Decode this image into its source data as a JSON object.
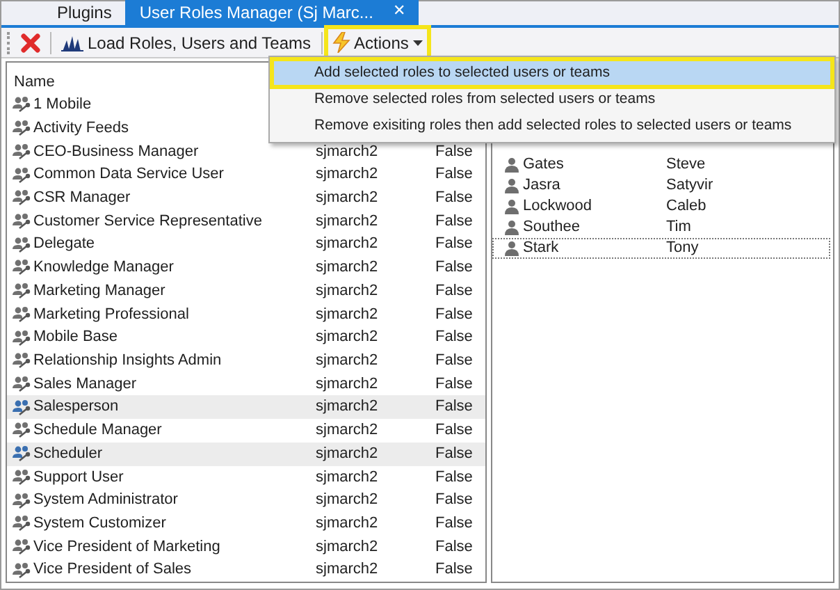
{
  "tabs": [
    {
      "label": "Plugins",
      "selected": false,
      "closable": false
    },
    {
      "label": "User Roles Manager (Sj Marc...",
      "selected": true,
      "closable": true,
      "close": "✕"
    }
  ],
  "toolbar": {
    "load_label": "Load Roles, Users and Teams",
    "actions_label": "Actions",
    "actions_highlighted": true
  },
  "menu": {
    "open": true,
    "items": [
      {
        "label": "Add selected roles to selected users or teams",
        "selected": true
      },
      {
        "label": "Remove selected roles from selected users or teams",
        "selected": false
      },
      {
        "label": "Remove exisiting roles then add selected roles to selected users or teams",
        "selected": false
      }
    ]
  },
  "roles": {
    "columns": [
      "Name"
    ],
    "rows": [
      {
        "name": "1 Mobile",
        "owner": "",
        "managed": "",
        "selected": false
      },
      {
        "name": "Activity Feeds",
        "owner": "",
        "managed": "",
        "selected": false
      },
      {
        "name": "CEO-Business Manager",
        "owner": "sjmarch2",
        "managed": "False",
        "selected": false
      },
      {
        "name": "Common Data Service User",
        "owner": "sjmarch2",
        "managed": "False",
        "selected": false
      },
      {
        "name": "CSR Manager",
        "owner": "sjmarch2",
        "managed": "False",
        "selected": false
      },
      {
        "name": "Customer Service Representative",
        "owner": "sjmarch2",
        "managed": "False",
        "selected": false
      },
      {
        "name": "Delegate",
        "owner": "sjmarch2",
        "managed": "False",
        "selected": false
      },
      {
        "name": "Knowledge Manager",
        "owner": "sjmarch2",
        "managed": "False",
        "selected": false
      },
      {
        "name": "Marketing Manager",
        "owner": "sjmarch2",
        "managed": "False",
        "selected": false
      },
      {
        "name": "Marketing Professional",
        "owner": "sjmarch2",
        "managed": "False",
        "selected": false
      },
      {
        "name": "Mobile Base",
        "owner": "sjmarch2",
        "managed": "False",
        "selected": false
      },
      {
        "name": "Relationship Insights Admin",
        "owner": "sjmarch2",
        "managed": "False",
        "selected": false
      },
      {
        "name": "Sales Manager",
        "owner": "sjmarch2",
        "managed": "False",
        "selected": false
      },
      {
        "name": "Salesperson",
        "owner": "sjmarch2",
        "managed": "False",
        "selected": true
      },
      {
        "name": "Schedule Manager",
        "owner": "sjmarch2",
        "managed": "False",
        "selected": false
      },
      {
        "name": "Scheduler",
        "owner": "sjmarch2",
        "managed": "False",
        "selected": true
      },
      {
        "name": "Support User",
        "owner": "sjmarch2",
        "managed": "False",
        "selected": false
      },
      {
        "name": "System Administrator",
        "owner": "sjmarch2",
        "managed": "False",
        "selected": false
      },
      {
        "name": "System Customizer",
        "owner": "sjmarch2",
        "managed": "False",
        "selected": false
      },
      {
        "name": "Vice President of Marketing",
        "owner": "sjmarch2",
        "managed": "False",
        "selected": false
      },
      {
        "name": "Vice President of Sales",
        "owner": "sjmarch2",
        "managed": "False",
        "selected": false
      }
    ]
  },
  "users": {
    "rows": [
      {
        "last_name": "Gates",
        "first_name": "Steve",
        "focused": false
      },
      {
        "last_name": "Jasra",
        "first_name": "Satyvir",
        "focused": false
      },
      {
        "last_name": "Lockwood",
        "first_name": "Caleb",
        "focused": false
      },
      {
        "last_name": "Southee",
        "first_name": "Tim",
        "focused": false
      },
      {
        "last_name": "Stark",
        "first_name": "Tony",
        "focused": true
      }
    ]
  }
}
